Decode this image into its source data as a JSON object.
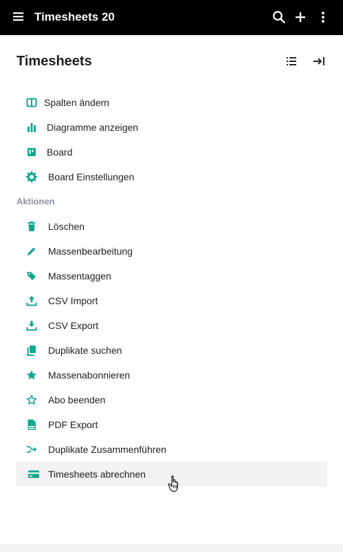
{
  "app": {
    "title": "Timesheets 20"
  },
  "panel": {
    "title": "Timesheets"
  },
  "view_items": [
    {
      "label": "Spalten ändern",
      "icon": "columns-icon"
    },
    {
      "label": "Diagramme anzeigen",
      "icon": "bar-chart-icon"
    },
    {
      "label": "Board",
      "icon": "board-icon"
    },
    {
      "label": "Board Einstellungen",
      "icon": "gear-icon"
    }
  ],
  "actions_label": "Aktionen",
  "action_items": [
    {
      "label": "Löschen",
      "icon": "trash-icon"
    },
    {
      "label": "Massenbearbeitung",
      "icon": "pencil-icon"
    },
    {
      "label": "Massentaggen",
      "icon": "tags-icon"
    },
    {
      "label": "CSV Import",
      "icon": "upload-icon"
    },
    {
      "label": "CSV Export",
      "icon": "download-icon"
    },
    {
      "label": "Duplikate suchen",
      "icon": "copy-icon"
    },
    {
      "label": "Massenabonnieren",
      "icon": "star-filled-icon"
    },
    {
      "label": "Abo beenden",
      "icon": "star-outline-icon"
    },
    {
      "label": "PDF Export",
      "icon": "pdf-icon"
    },
    {
      "label": "Duplikate Zusammenführen",
      "icon": "merge-icon"
    },
    {
      "label": "Timesheets abrechnen",
      "icon": "credit-card-icon"
    }
  ],
  "colors": {
    "accent": "#14a98b",
    "topbar": "#000000",
    "muted": "#8d94a1",
    "hover": "#f2f2f4"
  }
}
